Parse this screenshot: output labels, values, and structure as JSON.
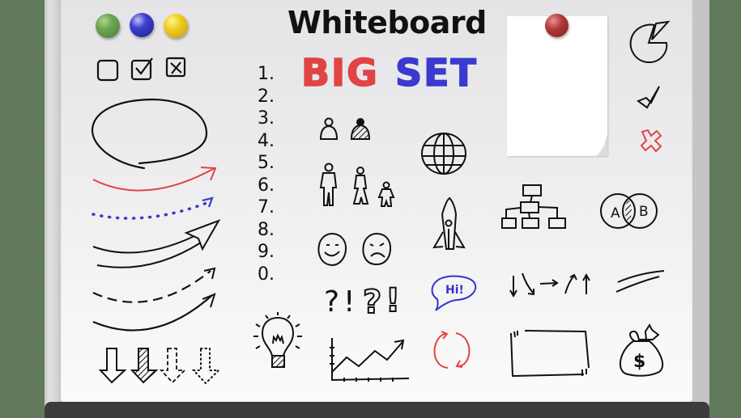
{
  "board": {
    "title": "Whiteboard",
    "subtitle_left": "BIG",
    "subtitle_right": "SET",
    "colors": {
      "wall": "#617a5c",
      "marker_black": "#111111",
      "marker_red": "#e04444",
      "marker_blue": "#3a3ad0",
      "tray": "#3c3c3c"
    }
  },
  "magnets": [
    {
      "name": "green-magnet",
      "color": "#6fa552"
    },
    {
      "name": "blue-magnet",
      "color": "#3b3fd0"
    },
    {
      "name": "yellow-magnet",
      "color": "#f0d020"
    },
    {
      "name": "red-pin-magnet",
      "color": "#b03838"
    }
  ],
  "numbered_list": [
    "1.",
    "2.",
    "3.",
    "4.",
    "5.",
    "6.",
    "7.",
    "8.",
    "9.",
    "0."
  ],
  "speech_bubble": {
    "text": "Hi!"
  },
  "punctuation": {
    "marks": [
      "?",
      "!",
      "?",
      "!"
    ]
  },
  "venn": {
    "left": "A",
    "right": "B"
  },
  "money_bag": {
    "symbol": "$"
  },
  "icons": [
    "checkbox-empty-icon",
    "checkbox-checked-icon",
    "checkbox-crossed-icon",
    "oval-speech-icon",
    "curved-arrow-icons",
    "down-arrow-icons",
    "person-icons",
    "family-icon",
    "smiley-icon",
    "sad-face-icon",
    "question-exclamation-icons",
    "lightbulb-icon",
    "line-chart-icon",
    "globe-icon",
    "rocket-icon",
    "speech-bubble-icon",
    "refresh-cycle-icon",
    "sticky-note-icon",
    "pie-chart-icon",
    "checkmark-icon",
    "red-cross-icon",
    "org-chart-icon",
    "venn-diagram-icon",
    "direction-arrows-icon",
    "double-line-icon",
    "frame-box-icon",
    "money-bag-icon"
  ]
}
